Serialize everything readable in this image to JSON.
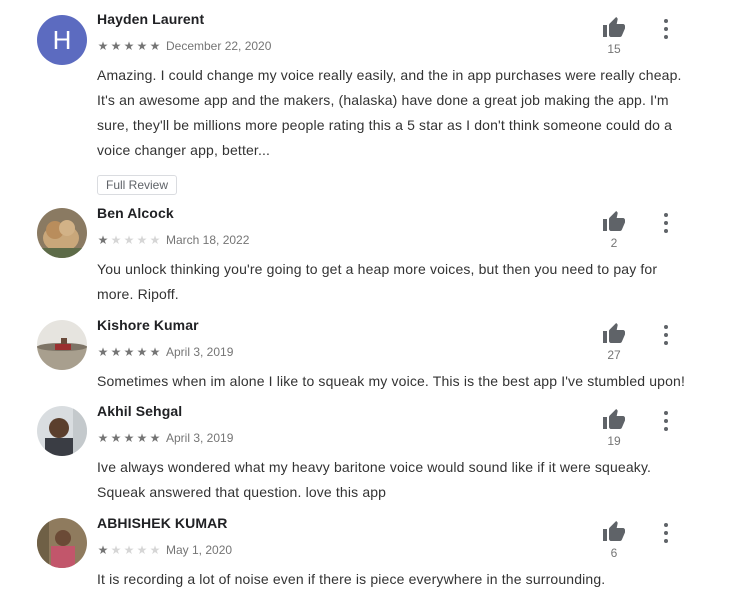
{
  "reviews": [
    {
      "name": "Hayden Laurent",
      "avatar": "H",
      "rating": 5,
      "date": "December 22, 2020",
      "likes": "15",
      "text": "Amazing. I could change my voice really easily, and the in app purchases were really cheap. It's an awesome app and the makers, (halaska) have done a great job making the app. I'm sure, they'll be millions more people rating this a 5 star as I don't think someone could do a voice changer app, better...",
      "full_review_label": "Full Review"
    },
    {
      "name": "Ben Alcock",
      "rating": 1,
      "date": "March 18, 2022",
      "likes": "2",
      "text": "You unlock thinking you're going to get a heap more voices, but then you need to pay for more. Ripoff."
    },
    {
      "name": "Kishore Kumar",
      "rating": 5,
      "date": "April 3, 2019",
      "likes": "27",
      "text": "Sometimes when im alone I like to squeak my voice. This is the best app I've stumbled upon!"
    },
    {
      "name": "Akhil Sehgal",
      "rating": 5,
      "date": "April 3, 2019",
      "likes": "19",
      "text": "Ive always wondered what my heavy baritone voice would sound like if it were squeaky. Squeak answered that question. love this app"
    },
    {
      "name": "ABHISHEK KUMAR",
      "rating": 1,
      "date": "May 1, 2020",
      "likes": "6",
      "text": "It is recording a lot of noise even if there is piece everywhere in the surrounding."
    }
  ],
  "icons": {
    "like": "thumbs-up-icon",
    "menu": "more-vert-icon",
    "star": "star-icon"
  },
  "colors": {
    "avatar_letter_bg": "#5c6bc0",
    "star_filled": "#757575",
    "star_empty": "#d6d6d6"
  }
}
